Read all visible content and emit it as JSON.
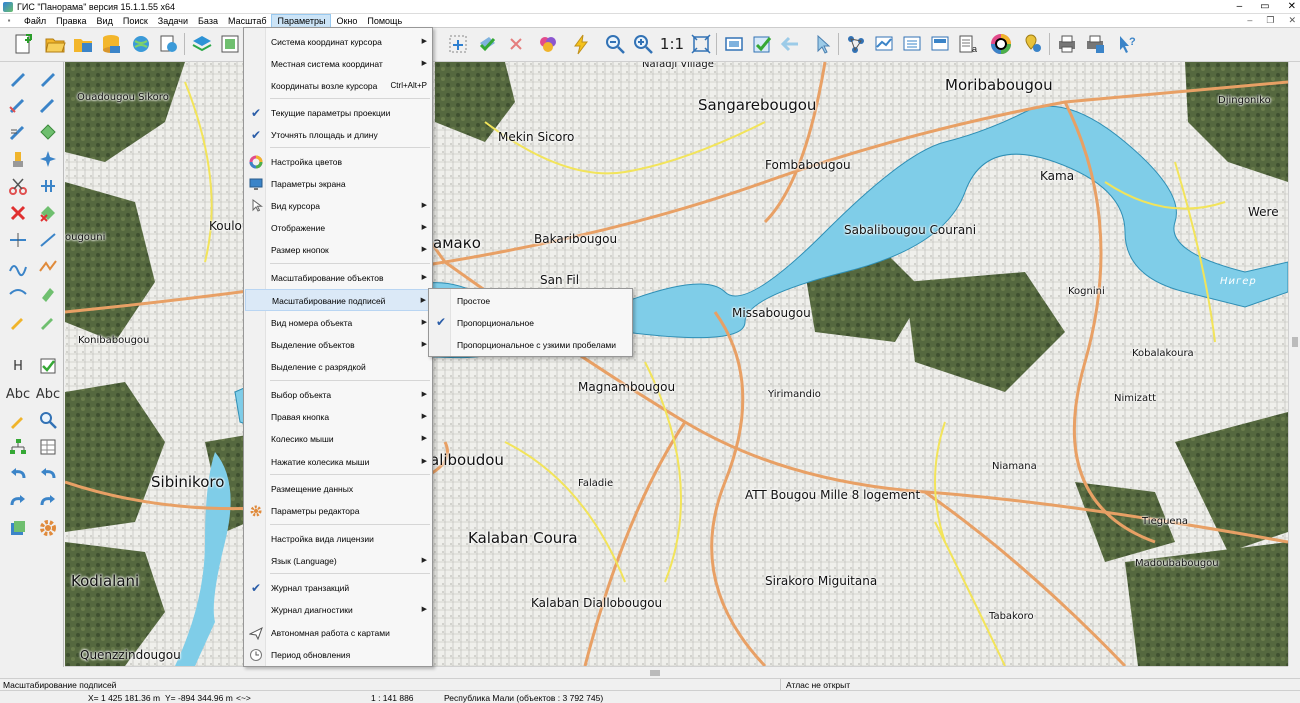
{
  "window": {
    "title": "ГИС \"Панорама\" версия 15.1.1.55 x64"
  },
  "menubar": {
    "items": [
      "Файл",
      "Правка",
      "Вид",
      "Поиск",
      "Задачи",
      "База",
      "Масштаб",
      "Параметры",
      "Окно",
      "Помощь"
    ],
    "active": "Параметры"
  },
  "toolbar": {
    "scale_label": "1:1"
  },
  "left_panel": {
    "label_h": "H",
    "label_abc1": "Abc",
    "label_abc2": "Abc"
  },
  "dropdown": {
    "items": [
      {
        "label": "Система координат курсора",
        "arrow": "▶"
      },
      {
        "label": "Местная система координат",
        "arrow": "▶"
      },
      {
        "label": "Координаты возле курсора",
        "shortcut": "Ctrl+Alt+P"
      },
      {
        "label": "Текущие параметры проекции",
        "check": "✔"
      },
      {
        "label": "Уточнять площадь и длину",
        "check": "✔"
      },
      {
        "label": "Настройка цветов",
        "icon": "color-wheel-icon"
      },
      {
        "label": "Параметры экрана",
        "icon": "monitor-icon"
      },
      {
        "label": "Вид курсора",
        "icon": "cursor-icon",
        "arrow": "▶"
      },
      {
        "label": "Отображение",
        "arrow": "▶"
      },
      {
        "label": "Размер кнопок",
        "arrow": "▶"
      },
      {
        "label": "Масштабирование объектов",
        "arrow": "▶"
      },
      {
        "label": "Масштабирование подписей",
        "arrow": "▶",
        "highlighted": true
      },
      {
        "label": "Вид номера объекта",
        "arrow": "▶"
      },
      {
        "label": "Выделение объектов",
        "arrow": "▶"
      },
      {
        "label": "Выделение с разрядкой"
      },
      {
        "label": "Выбор объекта",
        "arrow": "▶"
      },
      {
        "label": "Правая кнопка",
        "arrow": "▶"
      },
      {
        "label": "Колесико мыши",
        "arrow": "▶"
      },
      {
        "label": "Нажатие колесика мыши",
        "arrow": "▶"
      },
      {
        "label": "Размещение данных"
      },
      {
        "label": "Параметры редактора",
        "icon": "gear-icon"
      },
      {
        "label": "Настройка вида лицензии"
      },
      {
        "label": "Язык (Language)",
        "arrow": "▶"
      },
      {
        "label": "Журнал транзакций",
        "check": "✔"
      },
      {
        "label": "Журнал диагностики",
        "arrow": "▶"
      },
      {
        "label": "Автономная работа с картами",
        "icon": "plane-icon"
      },
      {
        "label": "Период обновления",
        "icon": "clock-icon"
      }
    ]
  },
  "submenu": {
    "items": [
      {
        "label": "Простое"
      },
      {
        "label": "Пропорциональное",
        "check": "✔"
      },
      {
        "label": "Пропорциональное с узкими пробелами"
      }
    ]
  },
  "map": {
    "labels": [
      "Moribabougou",
      "Sangarebougou",
      "Djingoniko",
      "Ouadougou Sikoro",
      "Mekin Sicoro",
      "Fombabougou",
      "Kama",
      "Were",
      "Kouloub",
      "Bakaribougou",
      "Sabalibougou Courani",
      "амако",
      "San Fil",
      "Kognini",
      "Нигер",
      "Konibabougou",
      "Missabougou",
      "Kobalakoura",
      "Magnambougou",
      "Yirimandio",
      "Nimizatt",
      "Niamana",
      "aliboudou",
      "Sibinikoro",
      "Faladie",
      "ATT Bougou Mille 8 logement",
      "Tieguena",
      "Kalaban Coura",
      "Madoubabougou",
      "Kodialani",
      "Sirakoro Miguitana",
      "Kalaban Diallobougou",
      "Tabakoro",
      "Quenzzindougou",
      "ougouni",
      "Nafadji Village"
    ],
    "colors": {
      "water": "#7fcde8",
      "road_major": "#e8a065",
      "road_minor": "#f2e45a",
      "urban": "#e9e9e4",
      "vegetation": "#4d5f3a"
    }
  },
  "status": {
    "left_text": "Масштабирование подписей",
    "right_text": "Атлас не открыт",
    "x": "X= 1 425 181.36 m",
    "y": "Y=   -894 344.96 m",
    "arrows": "<~>",
    "scale": "1 : 141 886",
    "region": "Республика Мали  (объектов : 3 792 745)"
  }
}
